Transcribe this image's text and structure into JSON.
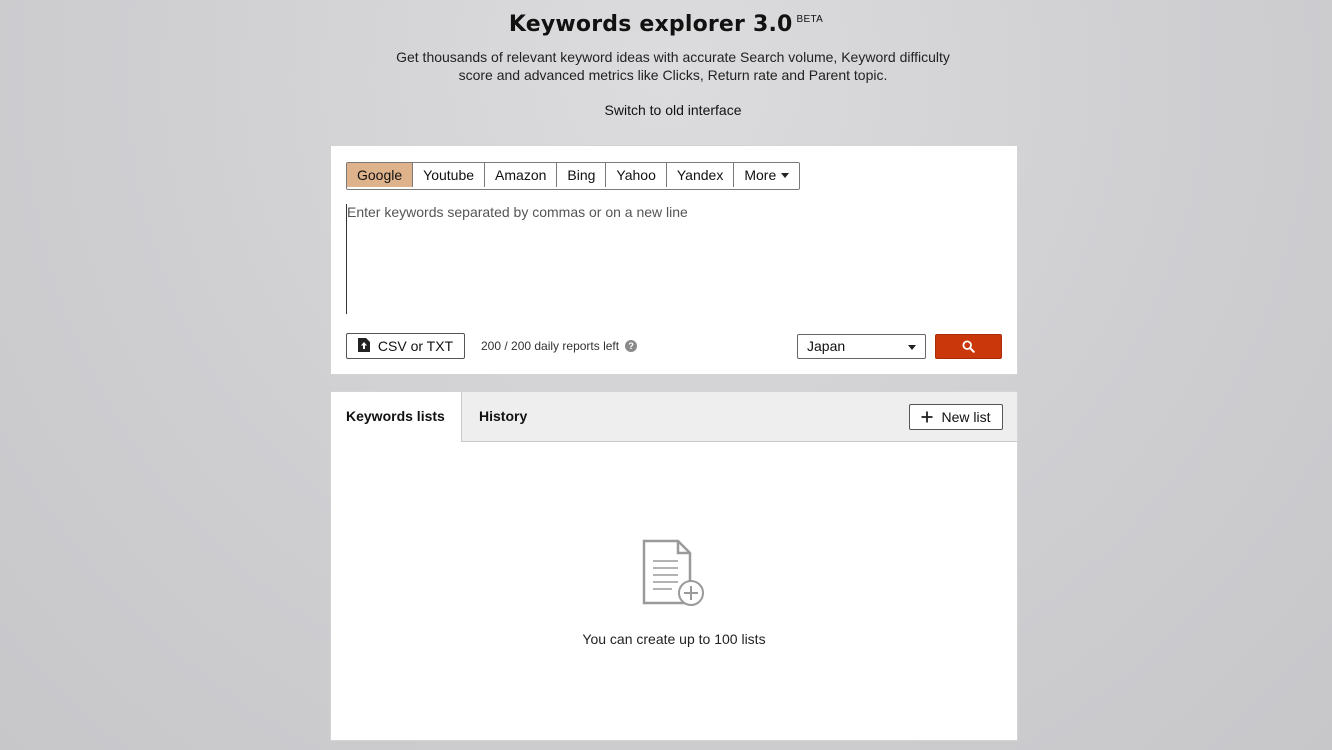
{
  "header": {
    "title": "Keywords explorer 3.0",
    "badge": "BETA",
    "subtitle": "Get thousands of relevant keyword ideas with accurate Search volume, Keyword difficulty score and advanced metrics like Clicks, Return rate and Parent topic.",
    "switch_link": "Switch to old interface"
  },
  "search": {
    "engines": [
      "Google",
      "Youtube",
      "Amazon",
      "Bing",
      "Yahoo",
      "Yandex",
      "More"
    ],
    "active_engine": "Google",
    "placeholder": "Enter keywords separated by commas or on a new line",
    "upload_label": "CSV or TXT",
    "reports_left": "200 / 200 daily reports left",
    "help_glyph": "?",
    "country": "Japan",
    "search_icon": "search-icon"
  },
  "lists": {
    "tabs": [
      "Keywords lists",
      "History"
    ],
    "active_tab": "Keywords lists",
    "new_list_label": "New list",
    "empty_text": "You can create up to 100 lists",
    "empty_icon": "document-add-icon"
  },
  "colors": {
    "active_engine_bg": "#deb38c",
    "search_button_bg": "#c9370a",
    "background": "#cfcfd2"
  }
}
